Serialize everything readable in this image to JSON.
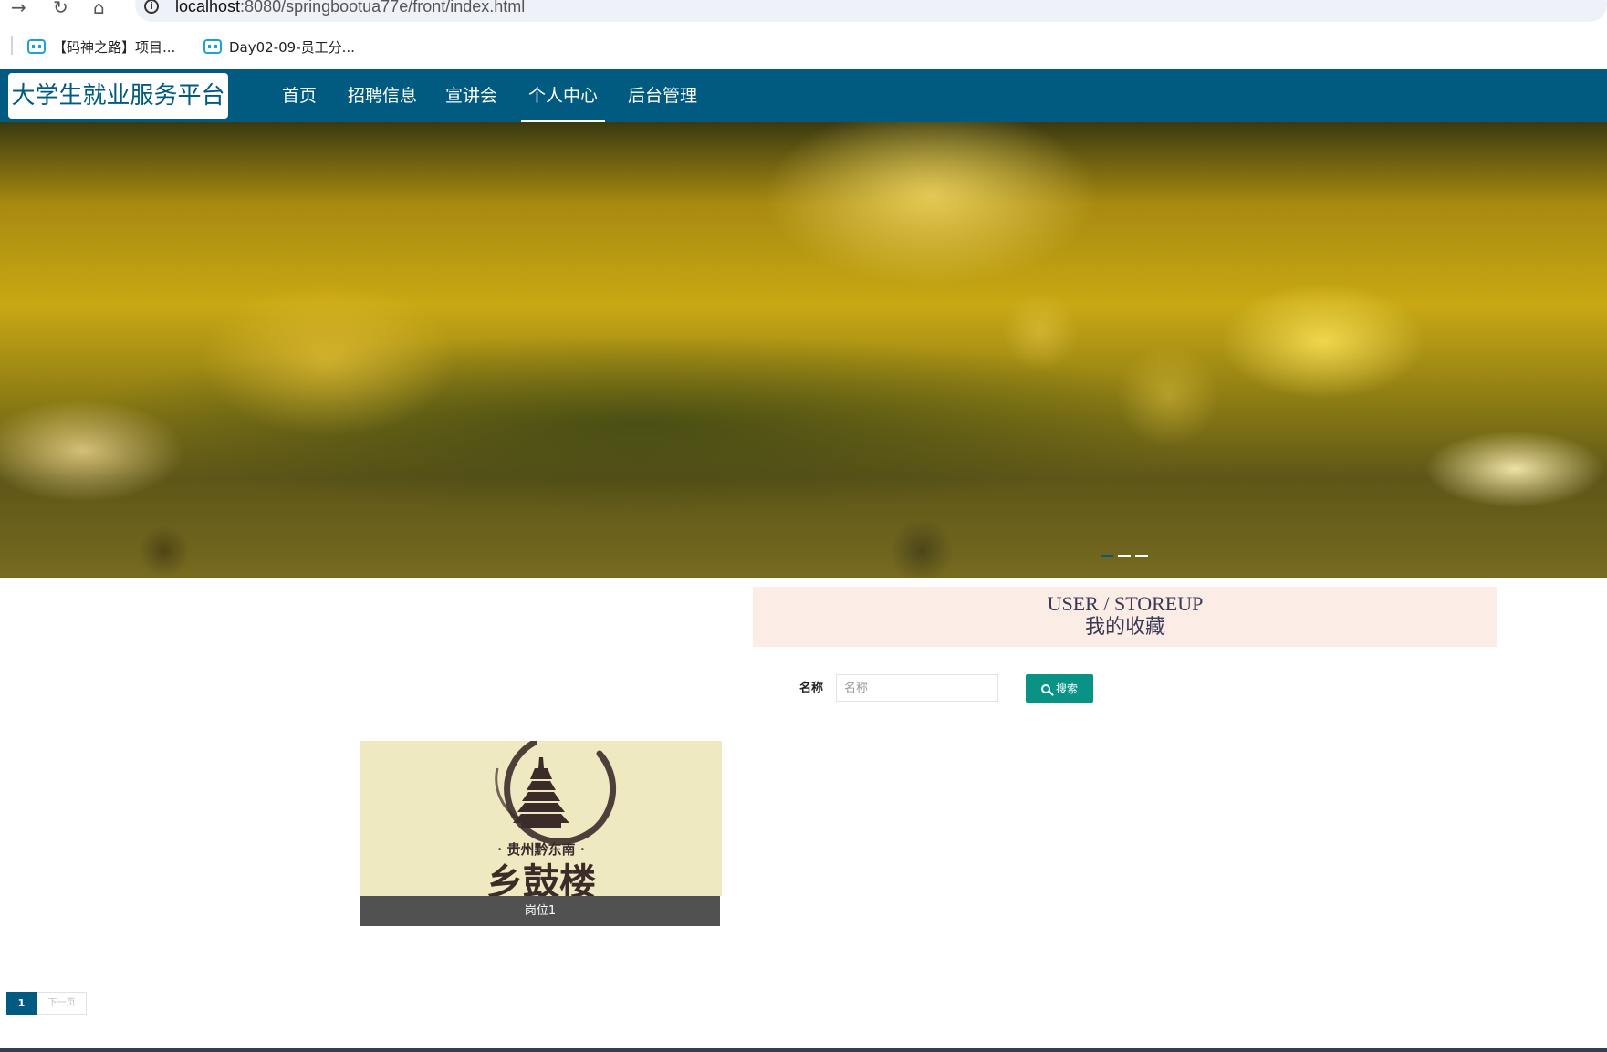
{
  "browser": {
    "url_host": "localhost",
    "url_path": ":8080/springbootua77e/front/index.html",
    "bookmarks": [
      {
        "label": "【码神之路】项目..."
      },
      {
        "label": "Day02-09-员工分..."
      }
    ]
  },
  "header": {
    "logo": "大学生就业服务平台",
    "nav": [
      {
        "label": "首页"
      },
      {
        "label": "招聘信息"
      },
      {
        "label": "宣讲会"
      },
      {
        "label": "个人中心",
        "active": true
      },
      {
        "label": "后台管理"
      }
    ]
  },
  "banner": {
    "slides": 3,
    "active_slide": 1
  },
  "storeup": {
    "title_en": "USER / STOREUP",
    "title_cn": "我的收藏"
  },
  "search": {
    "label": "名称",
    "placeholder": "名称",
    "value": "",
    "button_label": "搜索"
  },
  "cards": [
    {
      "title": "岗位1",
      "image_subtitle": "· 贵州黔东南 ·",
      "image_title": "乡鼓楼"
    }
  ],
  "pagination": {
    "current": "1",
    "next_label": "下一页"
  },
  "colors": {
    "brand": "#015a80",
    "search_button": "#099384",
    "title_bg": "#fbede6"
  }
}
